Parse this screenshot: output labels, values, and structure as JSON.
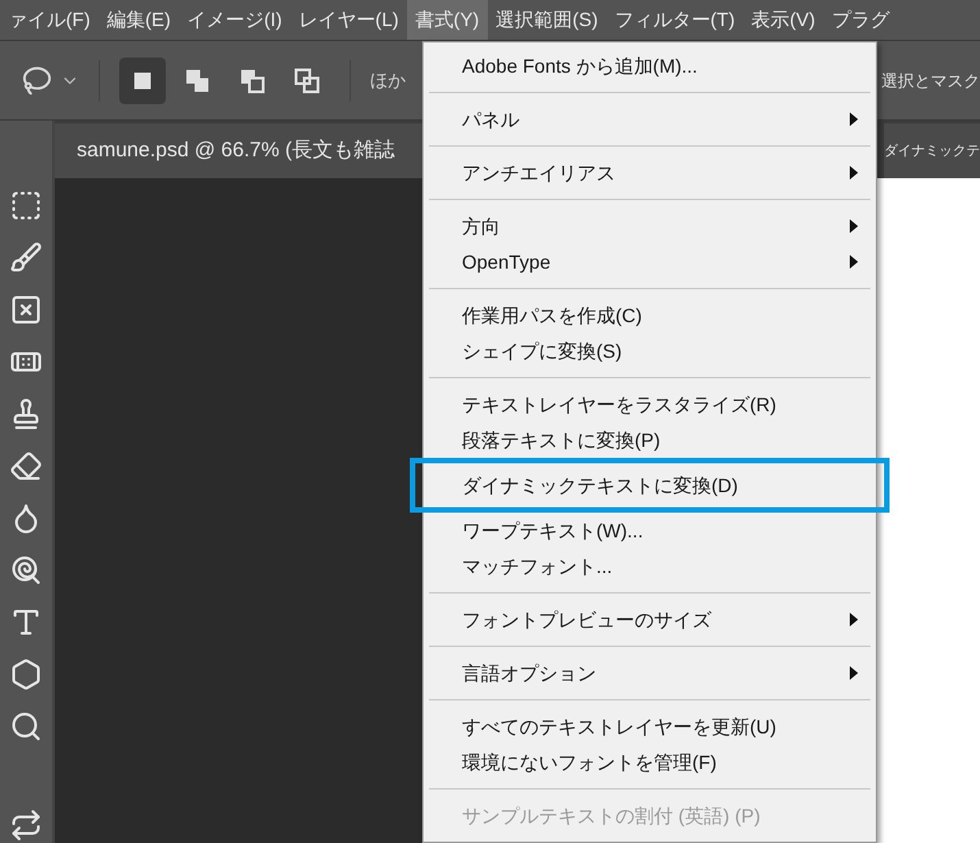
{
  "menu_bar": [
    {
      "label": "ァイル(F)",
      "selected": false
    },
    {
      "label": "編集(E)",
      "selected": false
    },
    {
      "label": "イメージ(I)",
      "selected": false
    },
    {
      "label": "レイヤー(L)",
      "selected": false
    },
    {
      "label": "書式(Y)",
      "selected": true
    },
    {
      "label": "選択範囲(S)",
      "selected": false
    },
    {
      "label": "フィルター(T)",
      "selected": false
    },
    {
      "label": "表示(V)",
      "selected": false
    },
    {
      "label": "プラグ",
      "selected": false
    }
  ],
  "options_bar": {
    "selection_modes": [
      {
        "selected": true
      },
      {
        "selected": false
      },
      {
        "selected": false
      },
      {
        "selected": false
      }
    ],
    "left_text": "ほか",
    "right_text": "選択とマスク"
  },
  "document_tabs": [
    {
      "label": "samune.psd @ 66.7% (長文も雑誌"
    },
    {
      "label": "ダイナミックテ"
    }
  ],
  "menu": {
    "groups": [
      [
        {
          "label": "Adobe Fonts から追加(M)...",
          "submenu": false,
          "disabled": false,
          "selected": false
        }
      ],
      [
        {
          "label": "パネル",
          "submenu": true,
          "disabled": false,
          "selected": false
        }
      ],
      [
        {
          "label": "アンチエイリアス",
          "submenu": true,
          "disabled": false,
          "selected": false
        }
      ],
      [
        {
          "label": "方向",
          "submenu": true,
          "disabled": false,
          "selected": false
        },
        {
          "label": "OpenType",
          "submenu": true,
          "disabled": false,
          "selected": false
        }
      ],
      [
        {
          "label": "作業用パスを作成(C)",
          "submenu": false,
          "disabled": false,
          "selected": false
        },
        {
          "label": "シェイプに変換(S)",
          "submenu": false,
          "disabled": false,
          "selected": false
        }
      ],
      [
        {
          "label": "テキストレイヤーをラスタライズ(R)",
          "submenu": false,
          "disabled": false,
          "selected": false
        },
        {
          "label": "段落テキストに変換(P)",
          "submenu": false,
          "disabled": false,
          "selected": false
        },
        {
          "label": "ダイナミックテキストに変換(D)",
          "submenu": false,
          "disabled": false,
          "selected": true
        },
        {
          "label": "ワープテキスト(W)...",
          "submenu": false,
          "disabled": false,
          "selected": false
        },
        {
          "label": "マッチフォント...",
          "submenu": false,
          "disabled": false,
          "selected": false
        }
      ],
      [
        {
          "label": "フォントプレビューのサイズ",
          "submenu": true,
          "disabled": false,
          "selected": false
        }
      ],
      [
        {
          "label": "言語オプション",
          "submenu": true,
          "disabled": false,
          "selected": false
        }
      ],
      [
        {
          "label": "すべてのテキストレイヤーを更新(U)",
          "submenu": false,
          "disabled": false,
          "selected": false
        },
        {
          "label": "環境にないフォントを管理(F)",
          "submenu": false,
          "disabled": false,
          "selected": false
        }
      ],
      [
        {
          "label": "サンプルテキストの割付 (英語) (P)",
          "submenu": false,
          "disabled": true,
          "selected": false
        }
      ]
    ]
  }
}
